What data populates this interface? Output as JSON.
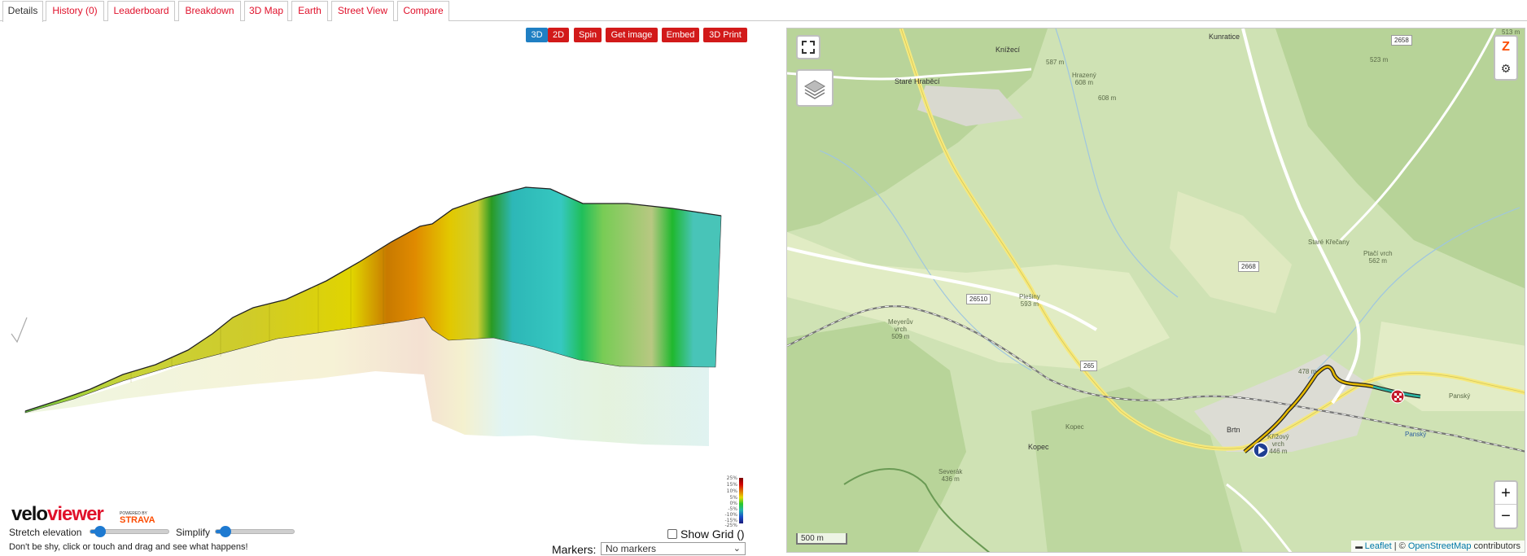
{
  "tabs": [
    {
      "label": "Details",
      "active": true
    },
    {
      "label": "History (0)"
    },
    {
      "label": "Leaderboard"
    },
    {
      "label": "Breakdown"
    },
    {
      "label": "3D Map"
    },
    {
      "label": "Earth"
    },
    {
      "label": "Street View"
    },
    {
      "label": "Compare"
    }
  ],
  "view_buttons": {
    "mode_3d": "3D",
    "mode_2d": "2D",
    "spin": "Spin",
    "get_image": "Get image",
    "embed": "Embed",
    "print3d": "3D Print"
  },
  "gradient_legend": {
    "labels": [
      "25%",
      "15%",
      "10%",
      "5%",
      "0%",
      "-5%",
      "-10%",
      "-15%",
      "-25%"
    ],
    "colors": [
      "#7a0000",
      "#d10000",
      "#e06f00",
      "#e5d800",
      "#28c828",
      "#22b0b0",
      "#1a4dc9",
      "#1a1a7a"
    ]
  },
  "branding": {
    "logo_part1": "velo",
    "logo_part2": "viewer",
    "powered_by": "POWERED BY",
    "strava": "STRAVA"
  },
  "controls": {
    "stretch_label": "Stretch elevation",
    "stretch_value": 0.12,
    "simplify_label": "Simplify",
    "simplify_value": 0.12,
    "hint": "Don't be shy, click or touch and drag and see what happens!",
    "show_grid_label": "Show Grid ()",
    "show_grid_checked": false,
    "markers_label": "Markers:",
    "markers_value": "No markers"
  },
  "map": {
    "place_labels": {
      "kunratice": "Kunratice",
      "knizeci": "Knížecí",
      "stare_hrabeci": "Staré Hraběcí",
      "hrazeny": "Hrazený\n608 m",
      "e587": "587 m",
      "e608": "608 m",
      "e523": "523 m",
      "e513": "513 m",
      "stare_krecany": "Staré Křečany",
      "ptaci_vrch": "Ptačí vrch\n562 m",
      "pleiny": "Plešiny\n593 m",
      "meyeruv": "Meyerův\nvrch\n509 m",
      "e478": "478 m",
      "pansky1": "Panský",
      "pansky2": "Panský",
      "brtniky": "Brtn",
      "krizovy": "Křížový\nvrch\n446 m",
      "kopec1": "Kopec",
      "kopec2": "Kopec",
      "severak": "Severák\n436 m"
    },
    "road_numbers": [
      "2658",
      "2668",
      "26510",
      "265"
    ],
    "scale_label": "500 m",
    "attribution_leaflet": "Leaflet",
    "attribution_sep": " | © ",
    "attribution_osm": "OpenStreetMap",
    "attribution_tail": " contributors",
    "zoom_in": "+",
    "zoom_out": "−"
  }
}
